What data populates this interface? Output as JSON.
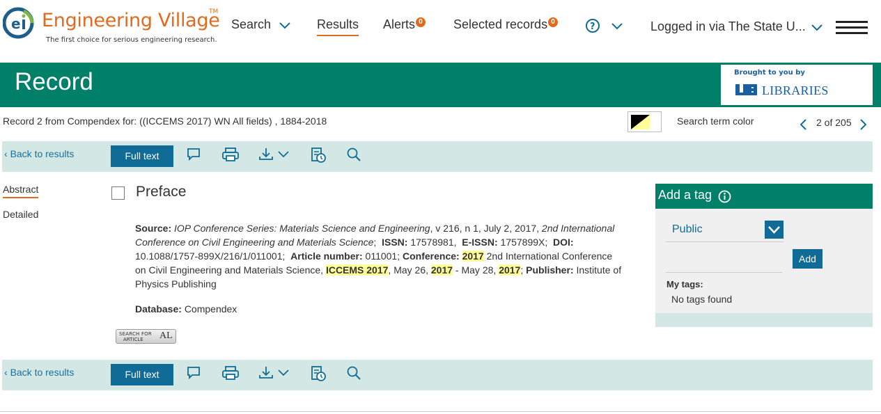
{
  "header": {
    "logo_title": "Engineering Village",
    "logo_tm": "TM",
    "logo_tagline": "The first choice for serious engineering research.",
    "nav": {
      "search": "Search",
      "results": "Results",
      "alerts": "Alerts",
      "alerts_count": "0",
      "selected": "Selected records",
      "selected_count": "0",
      "login": "Logged in via The State U..."
    },
    "icons": {
      "help": "help-circle-icon",
      "menu": "hamburger-menu-icon"
    }
  },
  "banner": {
    "title": "Record",
    "brought_by": "Brought to you by",
    "library": "LIBRARIES"
  },
  "record_info": {
    "text": "Record 2 from Compendex for: ((ICCEMS 2017) WN All fields) , 1884-2018",
    "search_term_color_label": "Search term color",
    "pager": "2 of 205"
  },
  "toolbar": {
    "back": "Back to results",
    "full_text": "Full text",
    "icons": [
      "comment-icon",
      "print-icon",
      "download-icon",
      "history-icon",
      "search-icon"
    ]
  },
  "sidebar": {
    "tabs": [
      {
        "label": "Abstract",
        "active": true
      },
      {
        "label": "Detailed",
        "active": false
      }
    ]
  },
  "record": {
    "title": "Preface",
    "source_label": "Source:",
    "source_journal": "IOP Conference Series: Materials Science and Engineering",
    "source_details": ", v 216, n 1, July 2, 2017, ",
    "source_conf_italic": "2nd International Conference on Civil Engineering and Materials Science",
    "issn_label": "ISSN:",
    "issn": "17578981",
    "eissn_label": "E-ISSN:",
    "eissn": "1757899X",
    "doi_label": "DOI:",
    "doi": "10.1088/1757-899X/216/1/011001",
    "article_label": "Article number:",
    "article": "011001",
    "conference_label": "Conference:",
    "conf_year1": "2017",
    "conf_name": " 2nd International Conference on Civil Engineering and Materials Science, ",
    "conf_acronym": "ICCEMS 2017",
    "conf_date1": ", May 26, ",
    "conf_year2": "2017",
    "conf_date2": " - May 28, ",
    "conf_year3": "2017",
    "publisher_label": "Publisher:",
    "publisher": "Institute of Physics Publishing",
    "database_label": "Database:",
    "database": "Compendex",
    "sfa_top": "SEARCH FOR",
    "sfa_bottom": "ARTICLE",
    "sfa_mark": "AL"
  },
  "tags": {
    "header": "Add a tag",
    "visibility": "Public",
    "add_button": "Add",
    "my_tags_label": "My tags:",
    "no_tags": "No tags found"
  },
  "colors": {
    "accent_orange": "#e06b1f",
    "brand_green": "#008069",
    "toolbar_bg": "#d3e8e5",
    "button_blue": "#106b97",
    "highlight": "#ffff99"
  }
}
